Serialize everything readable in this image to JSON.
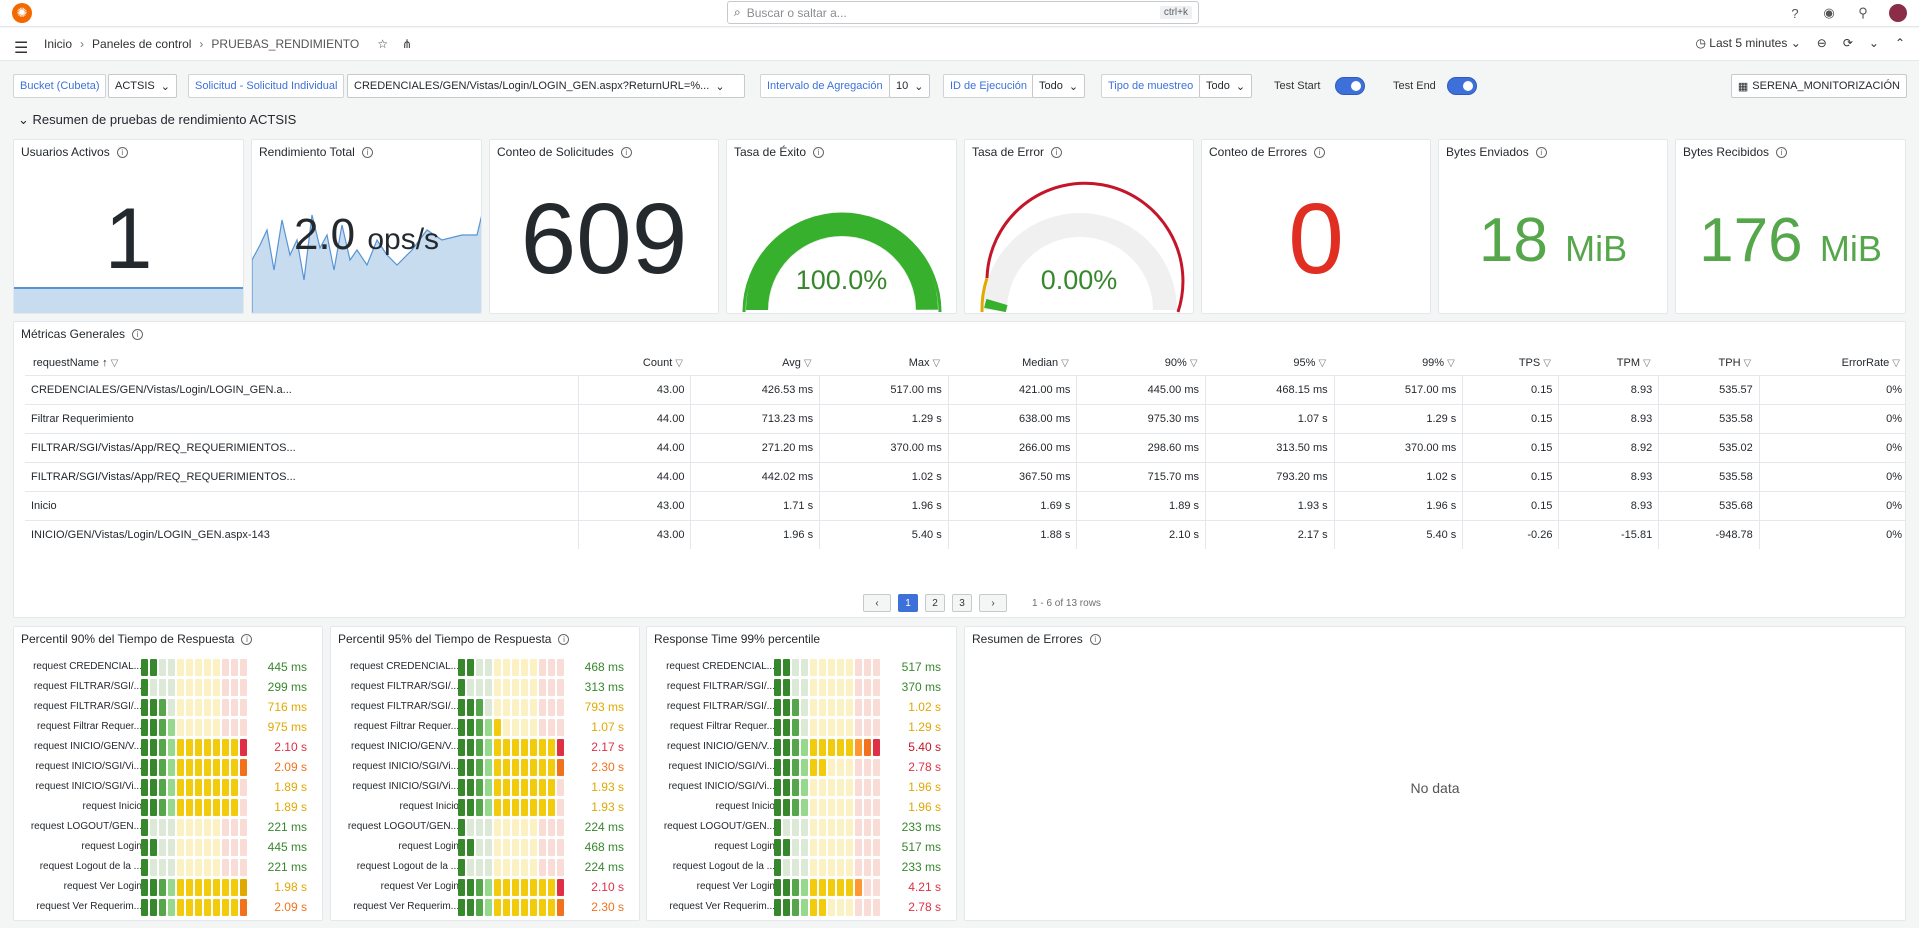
{
  "topbar": {
    "search_placeholder": "Buscar o saltar a...",
    "shortcut": "ctrl+k"
  },
  "breadcrumbs": [
    "Inicio",
    "Paneles de control",
    "PRUEBAS_RENDIMIENTO"
  ],
  "timepicker": "Last 5 minutes",
  "variables": {
    "bucket_label": "Bucket (Cubeta)",
    "bucket_value": "ACTSIS",
    "request_label": "Solicitud - Solicitud Individual",
    "request_value": "CREDENCIALES/GEN/Vistas/Login/LOGIN_GEN.aspx?ReturnURL=%...",
    "interval_label": "Intervalo de Agregación",
    "interval_value": "10",
    "exec_label": "ID de Ejecución",
    "exec_value": "Todo",
    "sample_label": "Tipo de muestreo",
    "sample_value": "Todo",
    "test_start": "Test Start",
    "test_end": "Test End",
    "dashboard_link": "SERENA_MONITORIZACIÓN"
  },
  "row_title": "Resumen de pruebas de rendimiento ACTSIS",
  "stats": [
    {
      "title": "Usuarios Activos",
      "value": "1"
    },
    {
      "title": "Rendimiento Total",
      "value": "2.0",
      "unit": "ops/s"
    },
    {
      "title": "Conteo de Solicitudes",
      "value": "609"
    },
    {
      "title": "Tasa de Éxito",
      "value": "100.0%"
    },
    {
      "title": "Tasa de Error",
      "value": "0.00%"
    },
    {
      "title": "Conteo de Errores",
      "value": "0"
    },
    {
      "title": "Bytes Enviados",
      "value": "18",
      "unit": "MiB"
    },
    {
      "title": "Bytes Recibidos",
      "value": "176",
      "unit": "MiB"
    }
  ],
  "gauges": {
    "success_fraction": 1.0,
    "error_fraction": 0.0
  },
  "metrics": {
    "title": "Métricas Generales",
    "columns": [
      "requestName",
      "Count",
      "Avg",
      "Max",
      "Median",
      "90%",
      "95%",
      "99%",
      "TPS",
      "TPM",
      "TPH",
      "ErrorRate"
    ],
    "rows": [
      [
        "CREDENCIALES/GEN/Vistas/Login/LOGIN_GEN.a...",
        "43.00",
        "426.53 ms",
        "517.00 ms",
        "421.00 ms",
        "445.00 ms",
        "468.15 ms",
        "517.00 ms",
        "0.15",
        "8.93",
        "535.57",
        "0%"
      ],
      [
        "Filtrar Requerimiento",
        "44.00",
        "713.23 ms",
        "1.29 s",
        "638.00 ms",
        "975.30 ms",
        "1.07 s",
        "1.29 s",
        "0.15",
        "8.93",
        "535.58",
        "0%"
      ],
      [
        "FILTRAR/SGI/Vistas/App/REQ_REQUERIMIENTOS...",
        "44.00",
        "271.20 ms",
        "370.00 ms",
        "266.00 ms",
        "298.60 ms",
        "313.50 ms",
        "370.00 ms",
        "0.15",
        "8.92",
        "535.02",
        "0%"
      ],
      [
        "FILTRAR/SGI/Vistas/App/REQ_REQUERIMIENTOS...",
        "44.00",
        "442.02 ms",
        "1.02 s",
        "367.50 ms",
        "715.70 ms",
        "793.20 ms",
        "1.02 s",
        "0.15",
        "8.93",
        "535.58",
        "0%"
      ],
      [
        "Inicio",
        "43.00",
        "1.71 s",
        "1.96 s",
        "1.69 s",
        "1.89 s",
        "1.93 s",
        "1.96 s",
        "0.15",
        "8.93",
        "535.68",
        "0%"
      ],
      [
        "INICIO/GEN/Vistas/Login/LOGIN_GEN.aspx-143",
        "43.00",
        "1.96 s",
        "5.40 s",
        "1.88 s",
        "2.10 s",
        "2.17 s",
        "5.40 s",
        "-0.26",
        "-15.81",
        "-948.78",
        "0%"
      ]
    ],
    "pages": [
      "1",
      "2",
      "3"
    ],
    "page_info": "1 - 6 of 13 rows"
  },
  "bargauges": [
    {
      "title": "Percentil 90% del Tiempo de Respuesta",
      "rows": [
        {
          "label": "request CREDENCIAL...",
          "value": "445 ms",
          "level": 2,
          "color": "#37872d"
        },
        {
          "label": "request FILTRAR/SGI/...",
          "value": "299 ms",
          "level": 1,
          "color": "#37872d"
        },
        {
          "label": "request FILTRAR/SGI/...",
          "value": "716 ms",
          "level": 3,
          "color": "#e0a800"
        },
        {
          "label": "request Filtrar Requer...",
          "value": "975 ms",
          "level": 4,
          "color": "#e0a800"
        },
        {
          "label": "request INICIO/GEN/V...",
          "value": "2.10 s",
          "level": 12,
          "color": "#e02f44"
        },
        {
          "label": "request INICIO/SGI/Vi...",
          "value": "2.09 s",
          "level": 12,
          "color": "#f2711c"
        },
        {
          "label": "request INICIO/SGI/Vi...",
          "value": "1.89 s",
          "level": 11,
          "color": "#e0a800"
        },
        {
          "label": "request Inicio",
          "value": "1.89 s",
          "level": 11,
          "color": "#e0a800"
        },
        {
          "label": "request LOGOUT/GEN...",
          "value": "221 ms",
          "level": 1,
          "color": "#37872d"
        },
        {
          "label": "request Login",
          "value": "445 ms",
          "level": 2,
          "color": "#37872d"
        },
        {
          "label": "request Logout de la ...",
          "value": "221 ms",
          "level": 1,
          "color": "#37872d"
        },
        {
          "label": "request Ver Login",
          "value": "1.98 s",
          "level": 12,
          "color": "#e0a800"
        },
        {
          "label": "request Ver Requerim...",
          "value": "2.09 s",
          "level": 12,
          "color": "#f2711c"
        }
      ]
    },
    {
      "title": "Percentil 95% del Tiempo de Respuesta",
      "rows": [
        {
          "label": "request CREDENCIAL...",
          "value": "468 ms",
          "level": 2,
          "color": "#37872d"
        },
        {
          "label": "request FILTRAR/SGI/...",
          "value": "313 ms",
          "level": 1,
          "color": "#37872d"
        },
        {
          "label": "request FILTRAR/SGI/...",
          "value": "793 ms",
          "level": 3,
          "color": "#e0a800"
        },
        {
          "label": "request Filtrar Requer...",
          "value": "1.07 s",
          "level": 5,
          "color": "#e0a800"
        },
        {
          "label": "request INICIO/GEN/V...",
          "value": "2.17 s",
          "level": 12,
          "color": "#e02f44"
        },
        {
          "label": "request INICIO/SGI/Vi...",
          "value": "2.30 s",
          "level": 12,
          "color": "#f2711c"
        },
        {
          "label": "request INICIO/SGI/Vi...",
          "value": "1.93 s",
          "level": 11,
          "color": "#e0a800"
        },
        {
          "label": "request Inicio",
          "value": "1.93 s",
          "level": 11,
          "color": "#e0a800"
        },
        {
          "label": "request LOGOUT/GEN...",
          "value": "224 ms",
          "level": 1,
          "color": "#37872d"
        },
        {
          "label": "request Login",
          "value": "468 ms",
          "level": 2,
          "color": "#37872d"
        },
        {
          "label": "request Logout de la ...",
          "value": "224 ms",
          "level": 1,
          "color": "#37872d"
        },
        {
          "label": "request Ver Login",
          "value": "2.10 s",
          "level": 12,
          "color": "#e02f44"
        },
        {
          "label": "request Ver Requerim...",
          "value": "2.30 s",
          "level": 12,
          "color": "#f2711c"
        }
      ]
    },
    {
      "title": "Response Time 99% percentile",
      "rows": [
        {
          "label": "request CREDENCIAL...",
          "value": "517 ms",
          "level": 2,
          "color": "#37872d"
        },
        {
          "label": "request FILTRAR/SGI/...",
          "value": "370 ms",
          "level": 2,
          "color": "#37872d"
        },
        {
          "label": "request FILTRAR/SGI/...",
          "value": "1.02 s",
          "level": 3,
          "color": "#e0a800"
        },
        {
          "label": "request Filtrar Requer...",
          "value": "1.29 s",
          "level": 3,
          "color": "#e0a800"
        },
        {
          "label": "request INICIO/GEN/V...",
          "value": "5.40 s",
          "level": 12,
          "color": "#c4162a"
        },
        {
          "label": "request INICIO/SGI/Vi...",
          "value": "2.78 s",
          "level": 6,
          "color": "#e02f44"
        },
        {
          "label": "request INICIO/SGI/Vi...",
          "value": "1.96 s",
          "level": 4,
          "color": "#e0a800"
        },
        {
          "label": "request Inicio",
          "value": "1.96 s",
          "level": 4,
          "color": "#e0a800"
        },
        {
          "label": "request LOGOUT/GEN...",
          "value": "233 ms",
          "level": 1,
          "color": "#37872d"
        },
        {
          "label": "request Login",
          "value": "517 ms",
          "level": 2,
          "color": "#37872d"
        },
        {
          "label": "request Logout de la ...",
          "value": "233 ms",
          "level": 1,
          "color": "#37872d"
        },
        {
          "label": "request Ver Login",
          "value": "4.21 s",
          "level": 10,
          "color": "#e02f44"
        },
        {
          "label": "request Ver Requerim...",
          "value": "2.78 s",
          "level": 6,
          "color": "#e02f44"
        }
      ]
    }
  ],
  "errors_panel": {
    "title": "Resumen de Errores",
    "empty": "No data"
  }
}
